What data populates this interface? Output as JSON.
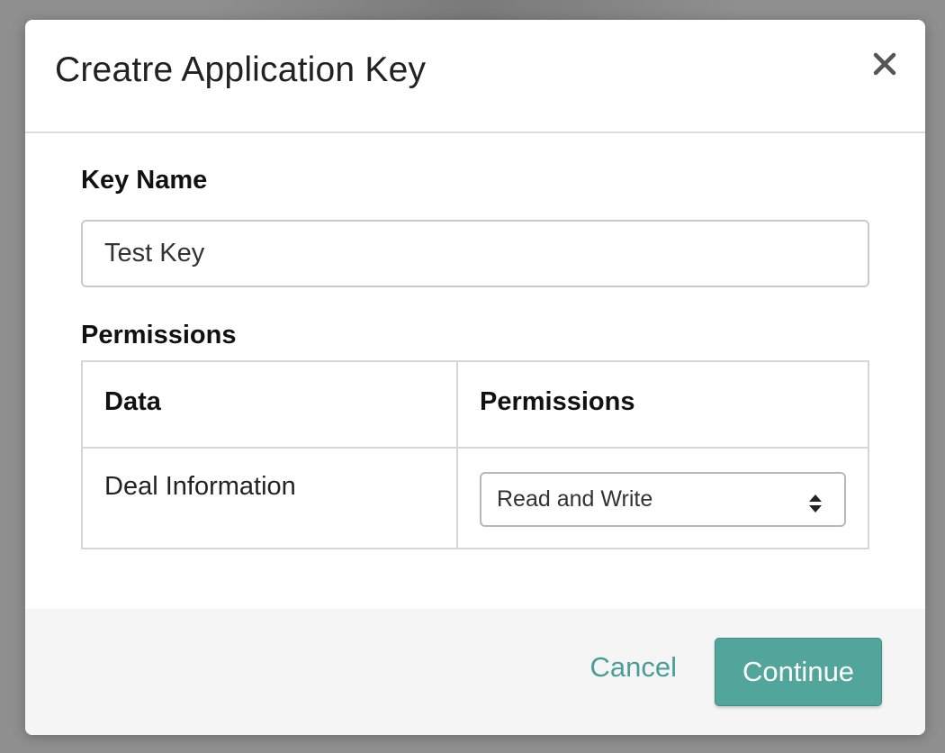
{
  "modal": {
    "title": "Creatre Application Key",
    "close_icon": "close-icon"
  },
  "form": {
    "key_name_label": "Key Name",
    "key_name_value": "Test Key",
    "permissions_label": "Permissions"
  },
  "permissions_table": {
    "headers": [
      "Data",
      "Permissions"
    ],
    "rows": [
      {
        "data": "Deal Information",
        "permission": "Read and Write"
      }
    ]
  },
  "footer": {
    "cancel_label": "Cancel",
    "continue_label": "Continue"
  },
  "colors": {
    "accent": "#52a59a",
    "link": "#4b9e97",
    "footer_bg": "#f5f5f5",
    "overlay": "#8c8c8c"
  }
}
